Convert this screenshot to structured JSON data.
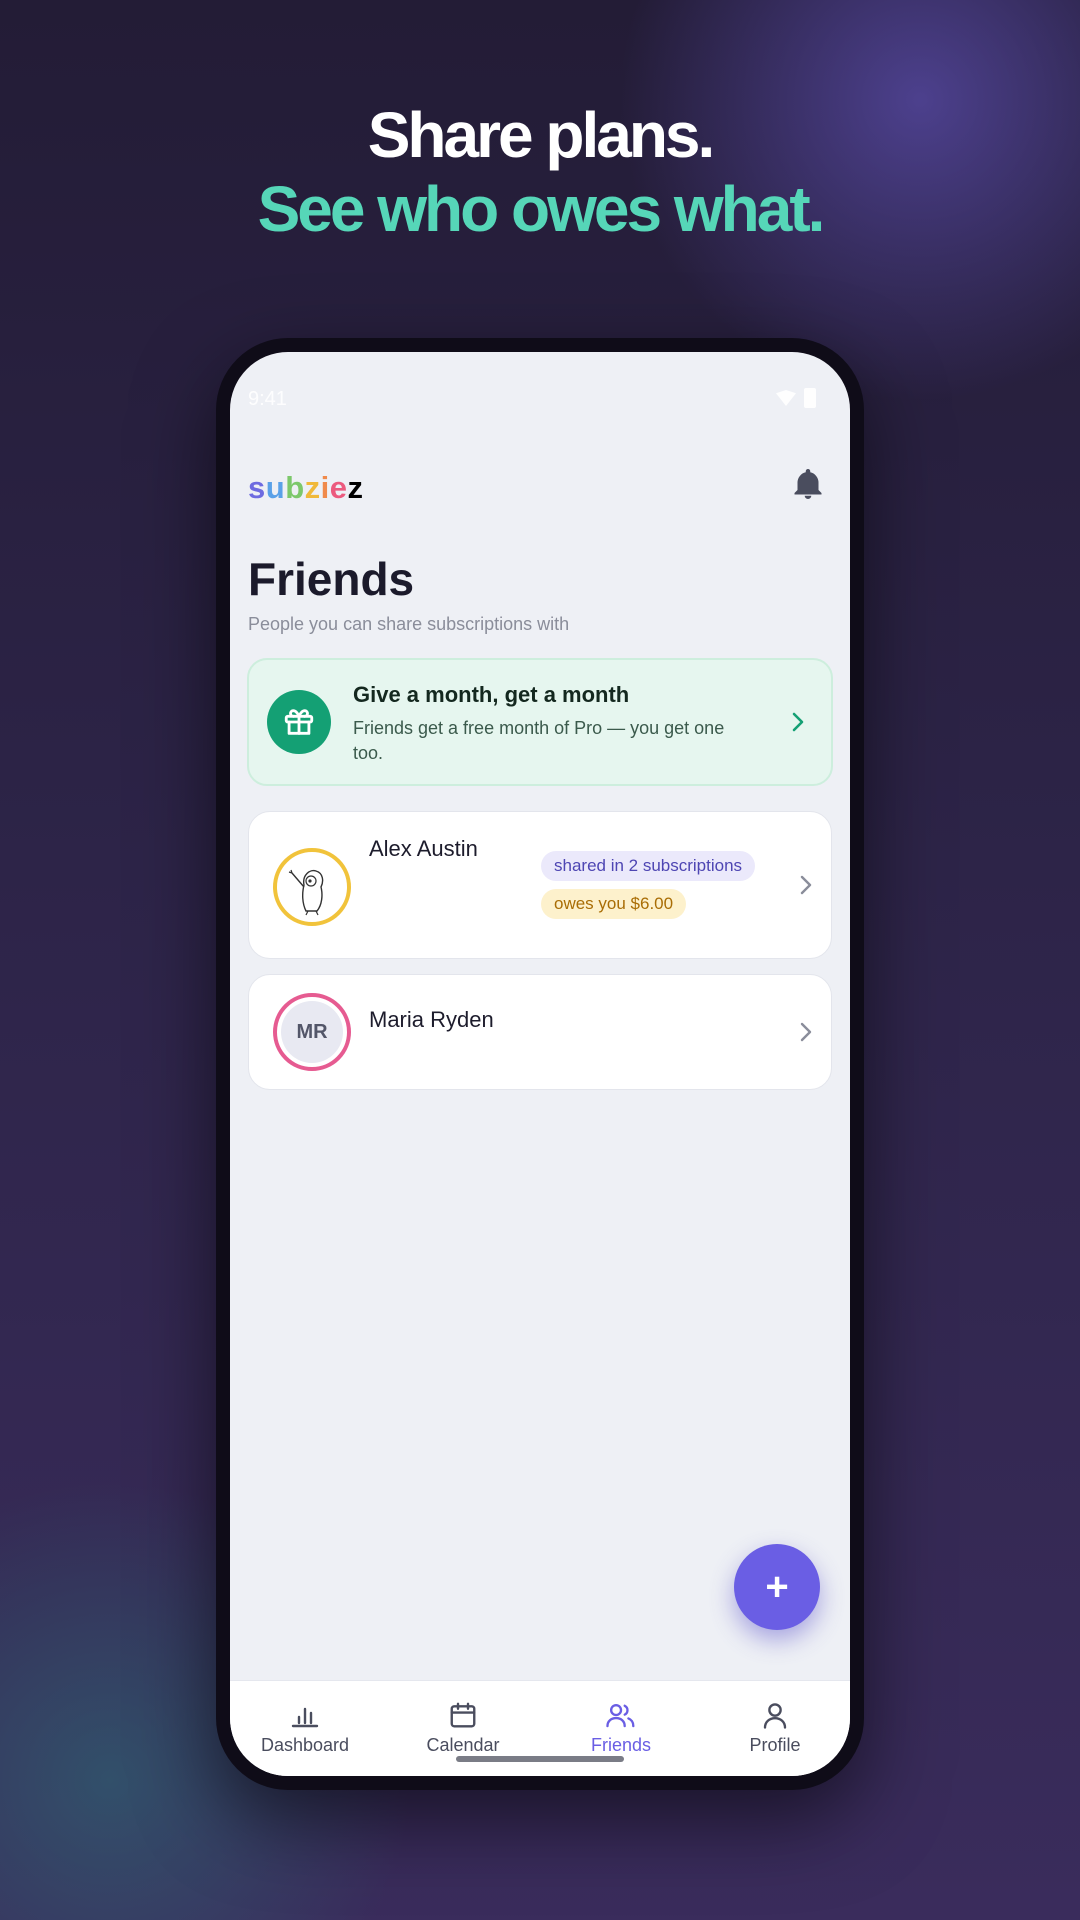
{
  "headline": {
    "line1": "Share plans.",
    "line2": "See who owes what."
  },
  "status_bar": {
    "time": "9:41"
  },
  "app": {
    "brand_letters": [
      "s",
      "u",
      "b",
      "z",
      "i",
      "e",
      "z"
    ]
  },
  "page": {
    "title": "Friends",
    "subtitle": "People you can share subscriptions with"
  },
  "promo": {
    "title": "Give a month, get a month",
    "description": "Friends get a free month of Pro — you get one too."
  },
  "friends": [
    {
      "name": "Alex Austin",
      "shared": "shared in 2 subscriptions",
      "owes": "owes you $6.00"
    },
    {
      "name": "Maria Ryden",
      "initials": "MR"
    }
  ],
  "fab": {
    "label": "+"
  },
  "nav": [
    {
      "label": "Dashboard",
      "icon": "bar-chart-icon"
    },
    {
      "label": "Calendar",
      "icon": "calendar-icon"
    },
    {
      "label": "Friends",
      "icon": "people-icon",
      "active": true
    },
    {
      "label": "Profile",
      "icon": "person-icon"
    }
  ],
  "colors": {
    "accent": "#6a5ee4",
    "headline_accent": "#56d6b8",
    "promo_green": "#14a074",
    "avatar_ring_yellow": "#f1c33b",
    "avatar_ring_pink": "#e65b91"
  }
}
